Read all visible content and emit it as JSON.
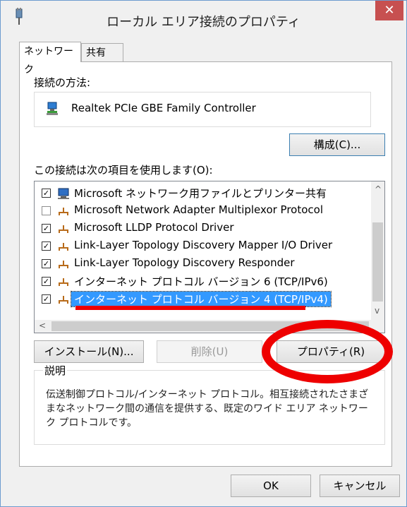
{
  "window": {
    "title": "ローカル エリア接続のプロパティ",
    "close_glyph": "✕"
  },
  "tabs": [
    {
      "label": "ネットワーク",
      "active": true
    },
    {
      "label": "共有",
      "active": false
    }
  ],
  "connect_using": {
    "label": "接続の方法:",
    "adapter_name": "Realtek PCIe GBE Family Controller",
    "configure_button": "構成(C)..."
  },
  "items_section": {
    "label": "この接続は次の項目を使用します(O):",
    "items": [
      {
        "label": "Microsoft ネットワーク用ファイルとプリンター共有",
        "checked": true,
        "icon": "network-computer-icon"
      },
      {
        "label": "Microsoft Network Adapter Multiplexor Protocol",
        "checked": false,
        "icon": "protocol-icon"
      },
      {
        "label": "Microsoft LLDP Protocol Driver",
        "checked": true,
        "icon": "protocol-icon"
      },
      {
        "label": "Link-Layer Topology Discovery Mapper I/O Driver",
        "checked": true,
        "icon": "protocol-icon"
      },
      {
        "label": "Link-Layer Topology Discovery Responder",
        "checked": true,
        "icon": "protocol-icon"
      },
      {
        "label": "インターネット プロトコル バージョン 6 (TCP/IPv6)",
        "checked": true,
        "icon": "protocol-icon"
      },
      {
        "label": "インターネット プロトコル バージョン 4 (TCP/IPv4)",
        "checked": true,
        "icon": "protocol-icon",
        "selected": true
      }
    ],
    "scroll_up": "^",
    "scroll_down": "v",
    "scroll_left": "<",
    "checkmark": "✓"
  },
  "buttons": {
    "install": "インストール(N)...",
    "uninstall": "削除(U)",
    "properties": "プロパティ(R)"
  },
  "description": {
    "legend": "説明",
    "text": "伝送制御プロトコル/インターネット プロトコル。相互接続されたさまざまなネットワーク間の通信を提供する、既定のワイド エリア ネットワーク プロトコルです。"
  },
  "footer": {
    "ok": "OK",
    "cancel": "キャンセル"
  },
  "colors": {
    "annotation_red": "#e00000",
    "selection_blue": "#3399ff",
    "close_red": "#c75050"
  }
}
